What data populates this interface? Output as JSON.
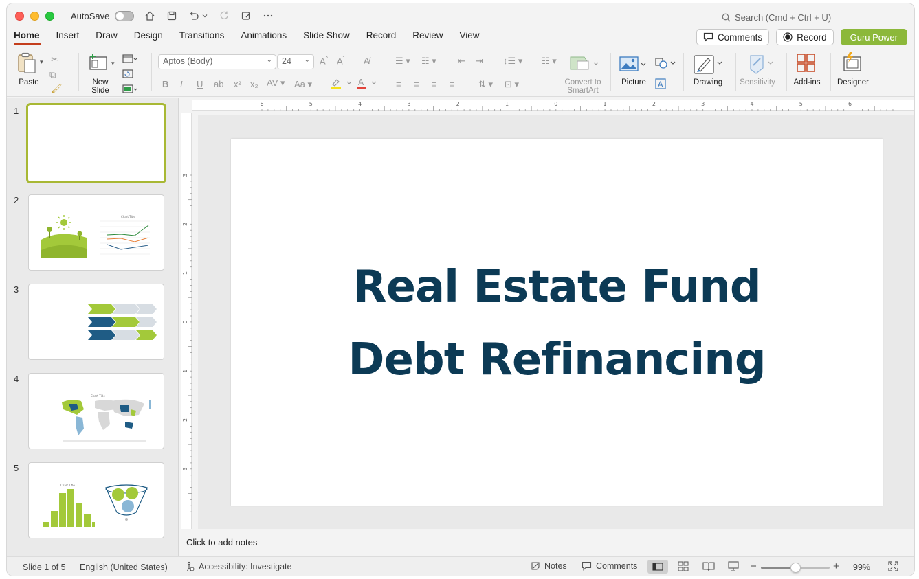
{
  "titlebar": {
    "autosave_label": "AutoSave",
    "search_placeholder": "Search (Cmd + Ctrl + U)"
  },
  "menu": {
    "tabs": [
      "Home",
      "Insert",
      "Draw",
      "Design",
      "Transitions",
      "Animations",
      "Slide Show",
      "Record",
      "Review",
      "View"
    ],
    "active": "Home",
    "comments_label": "Comments",
    "record_label": "Record",
    "guru_label": "Guru Power"
  },
  "ribbon": {
    "paste": "Paste",
    "new_slide_line1": "New",
    "new_slide_line2": "Slide",
    "font_name": "Aptos (Body)",
    "font_size": "24",
    "convert_line1": "Convert to",
    "convert_line2": "SmartArt",
    "picture": "Picture",
    "drawing": "Drawing",
    "sensitivity": "Sensitivity",
    "addins": "Add-ins",
    "designer": "Designer",
    "colors": {
      "highlight": "#f5e21b",
      "font_color": "#e2453c"
    }
  },
  "slides": {
    "numbers": [
      "1",
      "2",
      "3",
      "4",
      "5"
    ],
    "selected": 1,
    "thumb2_chart_title": "Chart Title",
    "thumb4_chart_title": "Chart Title",
    "thumb5_chart_title": "Chart Title"
  },
  "rulers": {
    "h_labels": [
      "6",
      "5",
      "4",
      "3",
      "2",
      "1",
      "0",
      "1",
      "2",
      "3",
      "4",
      "5",
      "6"
    ],
    "v_labels": [
      "3",
      "2",
      "1",
      "0",
      "1",
      "2",
      "3"
    ]
  },
  "slide": {
    "title_line1": "Real Estate Fund",
    "title_line2": "Debt Refinancing",
    "title_color": "#0c3a55"
  },
  "notes": {
    "placeholder": "Click to add notes"
  },
  "status": {
    "slide_info": "Slide 1 of 5",
    "language": "English (United States)",
    "accessibility": "Accessibility: Investigate",
    "notes_label": "Notes",
    "comments_label": "Comments",
    "zoom": "99%",
    "zoom_level": 0.5
  }
}
